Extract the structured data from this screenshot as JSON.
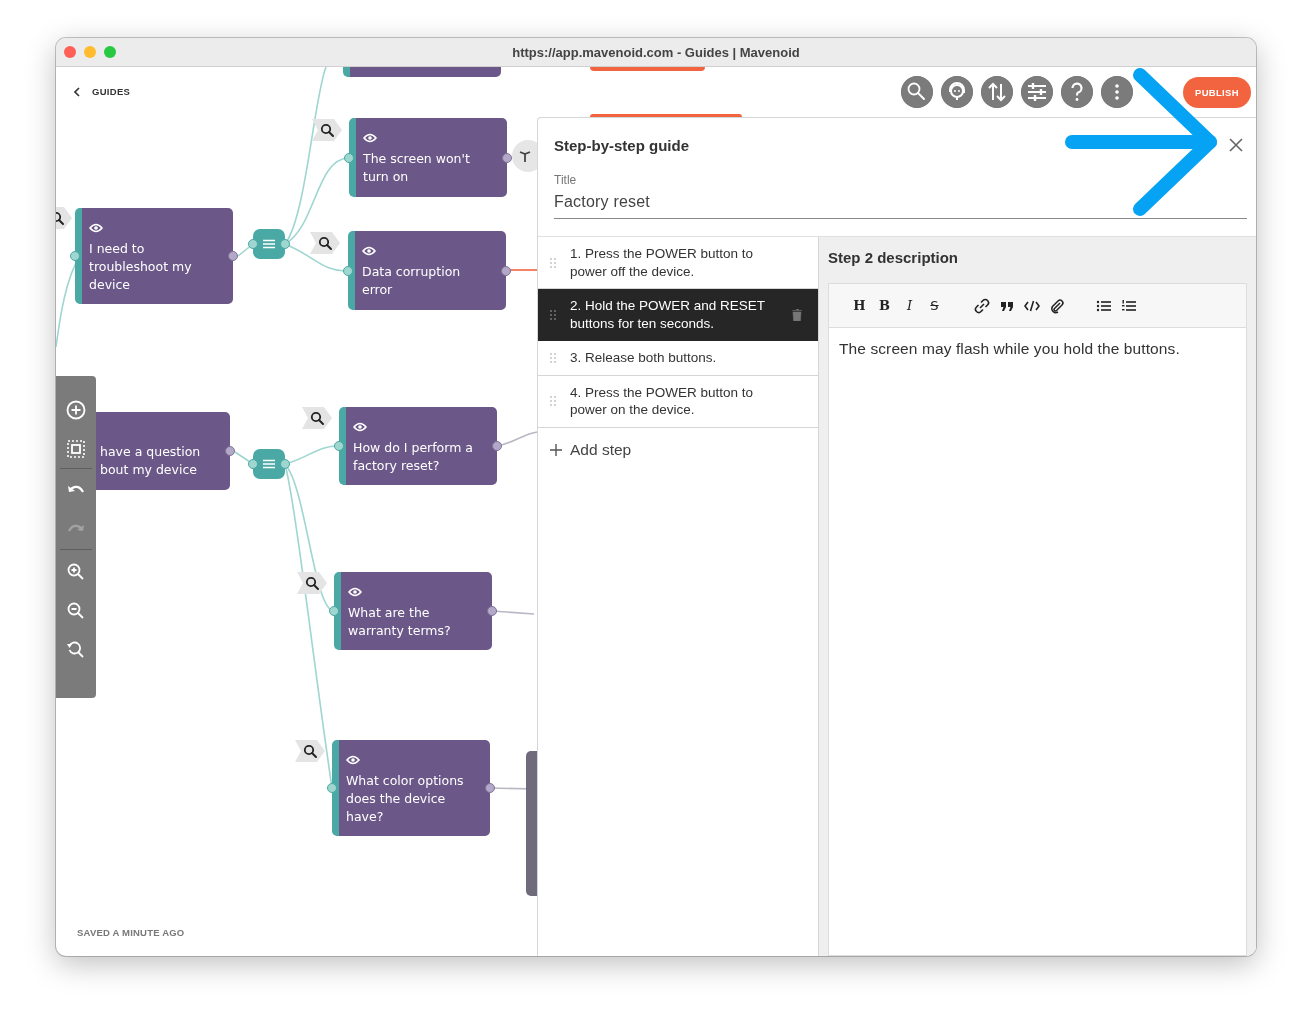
{
  "window": {
    "title": "https://app.mavenoid.com - Guides | Mavenoid"
  },
  "header": {
    "back_label": "GUIDES",
    "toolbar": [
      {
        "kind": "search"
      },
      {
        "kind": "support"
      },
      {
        "kind": "sort"
      },
      {
        "kind": "sliders"
      },
      {
        "kind": "help"
      },
      {
        "kind": "more"
      }
    ],
    "publish_button": "PUBLISH"
  },
  "canvas": {
    "nodes": [
      {
        "text": "The screen won't turn on"
      },
      {
        "text": "I need to troubleshoot my device"
      },
      {
        "text": "Data corruption error"
      },
      {
        "text": "have a question bout my device"
      },
      {
        "text": "How do I perform a factory reset?"
      },
      {
        "text": "What are the warranty terms?"
      },
      {
        "text": "What color options does the device have?"
      }
    ],
    "tools": [
      {
        "kind": "add",
        "disabled": false
      },
      {
        "kind": "select",
        "disabled": false
      },
      {
        "kind": "undo",
        "disabled": false
      },
      {
        "kind": "redo",
        "disabled": true
      },
      {
        "kind": "zoom_in",
        "disabled": false
      },
      {
        "kind": "zoom_out",
        "disabled": false
      },
      {
        "kind": "zoom_reset",
        "disabled": false
      }
    ],
    "status": "SAVED A MINUTE AGO"
  },
  "panel": {
    "title": "Step-by-step guide",
    "title_field": {
      "label": "Title",
      "value": "Factory reset"
    },
    "steps": [
      {
        "text": "1. Press the POWER button to power off the device.",
        "selected": false
      },
      {
        "text": "2. Hold the POWER and RESET buttons for ten seconds.",
        "selected": true
      },
      {
        "text": "3. Release both buttons.",
        "selected": false
      },
      {
        "text": "4. Press the POWER button to power on the device.",
        "selected": false
      }
    ],
    "add_step": "Add step",
    "description": {
      "heading": "Step 2 description",
      "editor_tools": [
        {
          "kind": "heading",
          "label": "H"
        },
        {
          "kind": "bold",
          "label": "B"
        },
        {
          "kind": "italic",
          "label": "I"
        },
        {
          "kind": "strike",
          "label": "S"
        },
        {
          "kind": "link"
        },
        {
          "kind": "quote"
        },
        {
          "kind": "code"
        },
        {
          "kind": "attach"
        },
        {
          "kind": "bullet_list"
        },
        {
          "kind": "numbered_list"
        }
      ],
      "body": "The screen may flash while you hold the buttons."
    }
  }
}
